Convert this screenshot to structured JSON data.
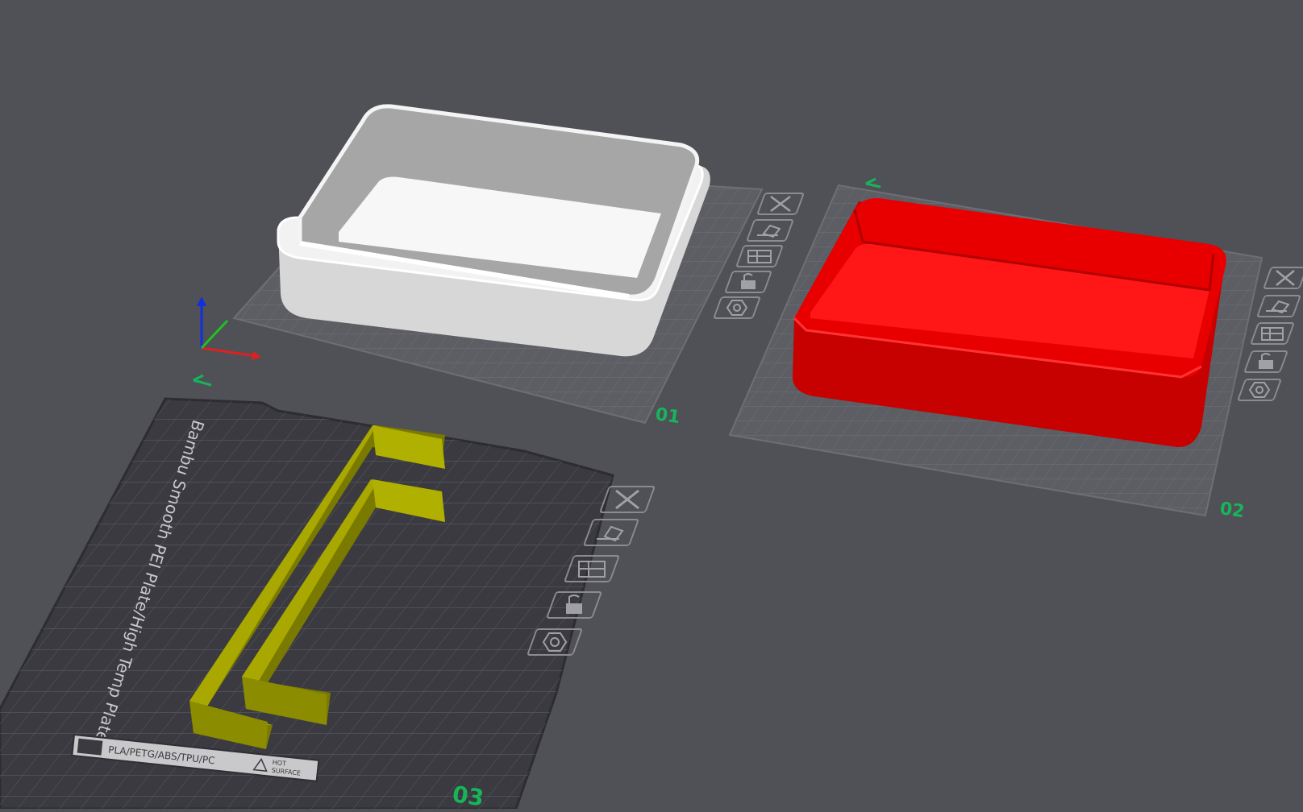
{
  "app": {
    "title": "",
    "viewport": "3D plate view"
  },
  "colors": {
    "background": "#505057",
    "plate_grid": "#6c6c72",
    "plate_label": "#17b45a",
    "object_white": "#e8e8e8",
    "object_red": "#ff1010",
    "object_olive": "#a2a200",
    "axis_x": "#e02020",
    "axis_y": "#20c020",
    "axis_z": "#1030e0"
  },
  "plates": [
    {
      "label": "01",
      "object": "white rounded box",
      "tools": [
        "close-icon",
        "auto-orient-icon",
        "arrange-icon",
        "lock-icon",
        "settings-icon"
      ]
    },
    {
      "label": "02",
      "object": "red rounded box",
      "tools": [
        "close-icon",
        "auto-orient-icon",
        "arrange-icon",
        "lock-icon",
        "settings-icon"
      ]
    },
    {
      "label": "03",
      "object": "olive bracket pair",
      "bed_text": "Bambu Smooth PEI Plate/High Temp Plate",
      "bed_footer_materials": "PLA/PETG/ABS/TPU/PC",
      "bed_footer_warning_line1": "HOT",
      "bed_footer_warning_line2": "SURFACE",
      "tools": [
        "close-icon",
        "auto-orient-icon",
        "arrange-icon",
        "lock-icon",
        "settings-icon"
      ]
    }
  ]
}
